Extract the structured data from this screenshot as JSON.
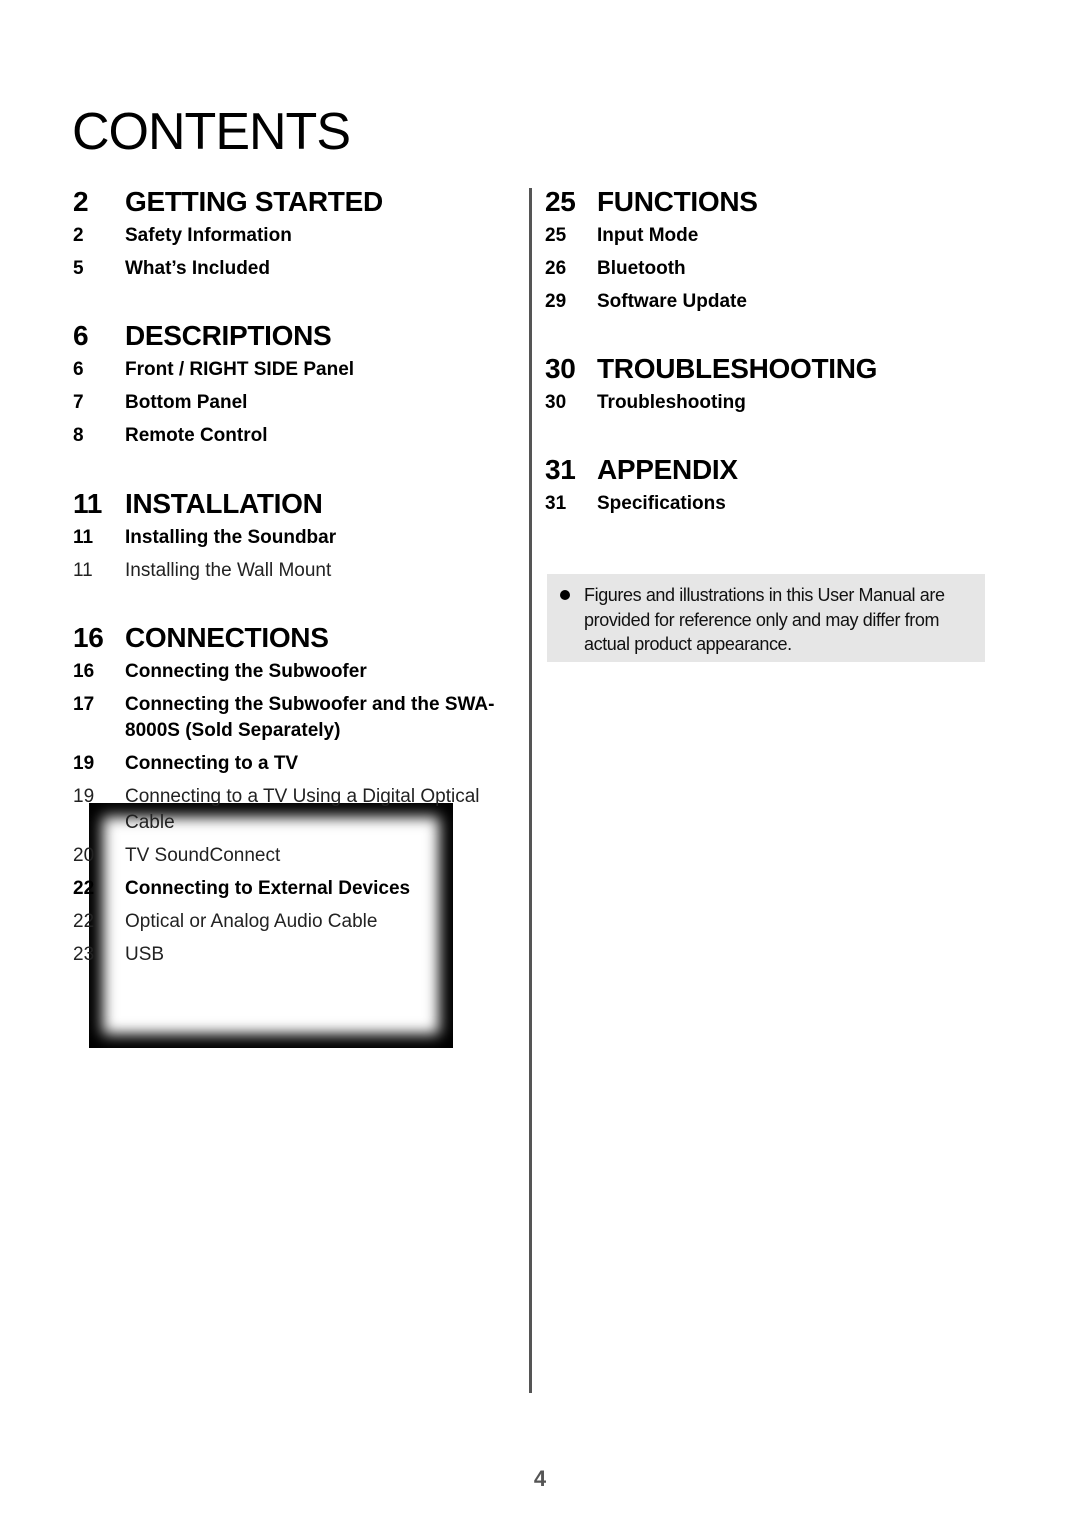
{
  "page": {
    "title": "CONTENTS",
    "page_number": "4"
  },
  "left_column": [
    {
      "number": "2",
      "title": "GETTING STARTED",
      "entries": [
        {
          "number": "2",
          "label": "Safety Information",
          "style": "bold"
        },
        {
          "number": "5",
          "label": "What’s Included",
          "style": "bold"
        }
      ]
    },
    {
      "number": "6",
      "title": "DESCRIPTIONS",
      "entries": [
        {
          "number": "6",
          "label": "Front / RIGHT SIDE Panel",
          "style": "bold"
        },
        {
          "number": "7",
          "label": "Bottom Panel",
          "style": "bold"
        },
        {
          "number": "8",
          "label": "Remote Control",
          "style": "bold"
        }
      ]
    },
    {
      "number": "11",
      "title": "INSTALLATION",
      "entries": [
        {
          "number": "11",
          "label": "Installing the Soundbar",
          "style": "bold"
        },
        {
          "number": "11",
          "label": "Installing the Wall Mount",
          "style": "light"
        }
      ]
    },
    {
      "number": "16",
      "title": "CONNECTIONS",
      "entries": [
        {
          "number": "16",
          "label": "Connecting the Subwoofer",
          "style": "bold"
        },
        {
          "number": "17",
          "label": "Connecting the Subwoofer and the SWA-8000S (Sold Separately)",
          "style": "bold"
        },
        {
          "number": "19",
          "label": "Connecting to a TV",
          "style": "bold"
        },
        {
          "number": "19",
          "label": "Connecting to a TV Using a Digital Optical Cable",
          "style": "light"
        },
        {
          "number": "20",
          "label": "TV SoundConnect",
          "style": "light"
        },
        {
          "number": "22",
          "label": "Connecting to External Devices",
          "style": "bold"
        },
        {
          "number": "22",
          "label": "Optical or Analog Audio Cable",
          "style": "light"
        },
        {
          "number": "23",
          "label": "USB",
          "style": "light"
        }
      ]
    }
  ],
  "right_column": [
    {
      "number": "25",
      "title": "FUNCTIONS",
      "entries": [
        {
          "number": "25",
          "label": "Input Mode",
          "style": "bold"
        },
        {
          "number": "26",
          "label": "Bluetooth",
          "style": "bold"
        },
        {
          "number": "29",
          "label": "Software Update",
          "style": "bold"
        }
      ]
    },
    {
      "number": "30",
      "title": "TROUBLESHOOTING",
      "entries": [
        {
          "number": "30",
          "label": "Troubleshooting",
          "style": "bold"
        }
      ]
    },
    {
      "number": "31",
      "title": "APPENDIX",
      "entries": [
        {
          "number": "31",
          "label": "Specifications",
          "style": "bold"
        }
      ]
    }
  ],
  "note": {
    "icon": "bullet-icon",
    "text": "Figures and illustrations in this User Manual are provided for reference only and may differ from actual product appearance."
  },
  "colors": {
    "note_background": "#e6e6e6",
    "divider": "#555555",
    "page_number": "#555555"
  }
}
